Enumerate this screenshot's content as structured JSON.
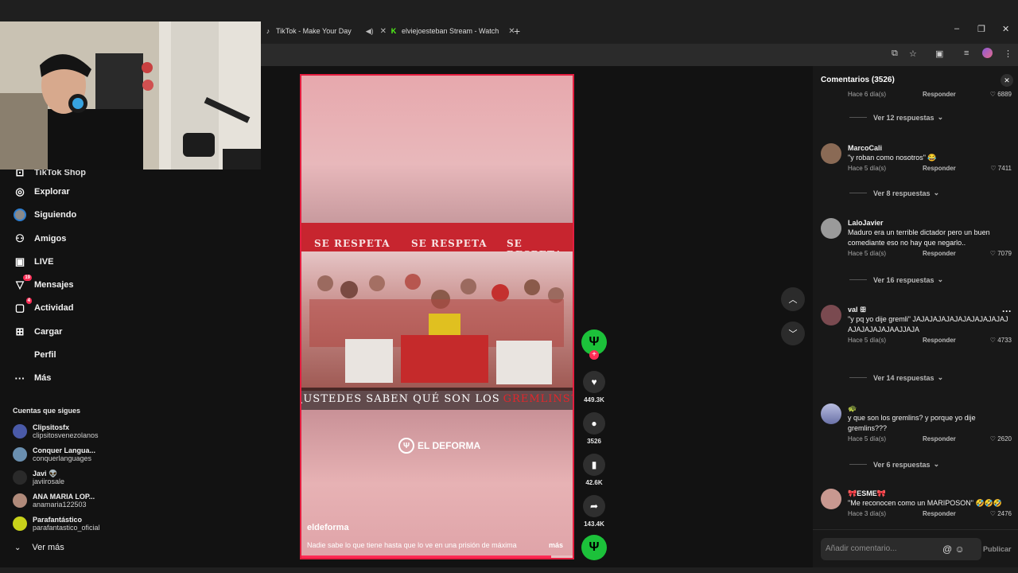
{
  "browser": {
    "tabs": [
      {
        "title": "TikTok - Make Your Day",
        "icon": "tiktok-icon"
      },
      {
        "title": "elviejoesteban Stream - Watch",
        "icon": "kick-icon"
      }
    ],
    "new_tab": "+",
    "window": {
      "minimize": "–",
      "restore": "❐",
      "close": "✕"
    }
  },
  "sidebar": {
    "partial_item": "TikTok Shop",
    "items": [
      {
        "label": "Explorar",
        "icon": "compass-icon",
        "glyph": "◎",
        "badge": ""
      },
      {
        "label": "Siguiendo",
        "icon": "following-icon",
        "glyph": "●",
        "badge": ""
      },
      {
        "label": "Amigos",
        "icon": "friends-icon",
        "glyph": "⚇",
        "badge": ""
      },
      {
        "label": "LIVE",
        "icon": "live-icon",
        "glyph": "▣",
        "badge": ""
      },
      {
        "label": "Mensajes",
        "icon": "messages-icon",
        "glyph": "▽",
        "badge": "19"
      },
      {
        "label": "Actividad",
        "icon": "activity-icon",
        "glyph": "▢",
        "badge": "4"
      },
      {
        "label": "Cargar",
        "icon": "upload-icon",
        "glyph": "⊞",
        "badge": ""
      },
      {
        "label": "Perfil",
        "icon": "profile-icon",
        "glyph": "",
        "badge": ""
      },
      {
        "label": "Más",
        "icon": "more-icon",
        "glyph": "···",
        "badge": ""
      }
    ],
    "following_title": "Cuentas que sigues",
    "following": [
      {
        "name": "Clipsitosfx",
        "handle": "clipsitosvenezolanos",
        "color": "#4a5aa8"
      },
      {
        "name": "Conquer Langua...",
        "handle": "conquerlanguages",
        "color": "#6a8fb0"
      },
      {
        "name": "Javi 👽",
        "handle": "javiirosale",
        "color": "#2a2a2a"
      },
      {
        "name": "ANA MARIA LOP...",
        "handle": "anamaria122503",
        "color": "#b08a7a"
      },
      {
        "name": "Parafantástico",
        "handle": "parafantastico_oficial",
        "color": "#c8d21a"
      }
    ],
    "see_more": "Ver más"
  },
  "video": {
    "banner_text": "SE RESPETA",
    "caption_white": "¿USTEDES SABEN QUÉ SON LOS",
    "caption_red": "GREMLINS?",
    "logo_text": "EL DEFORMA",
    "author": "eldeforma",
    "description": "Nadie sabe lo que tiene hasta que lo ve en una prisión de máxima",
    "more": "más",
    "progress": 0.92
  },
  "actions": {
    "likes": "449.3K",
    "comments": "3526",
    "saves": "42.6K",
    "shares": "143.4K"
  },
  "comments": {
    "title": "Comentarios (3526)",
    "top_partial": {
      "time": "Hace 6 día(s)",
      "reply": "Responder",
      "likes": "6889"
    },
    "items": [
      {
        "replies_before": "Ver 12 respuestas",
        "user": "MarcoCali",
        "text": "\"y roban como nosotros\" 😂",
        "time": "Hace 5 día(s)",
        "reply": "Responder",
        "likes": "7411",
        "color": "#8a6a55"
      },
      {
        "replies_before": "Ver 8 respuestas",
        "user": "LaloJavier",
        "text": "Maduro era un terrible dictador pero un buen comediante eso no hay que negarlo..",
        "time": "Hace 5 día(s)",
        "reply": "Responder",
        "likes": "7079",
        "color": "#9a9a9a"
      },
      {
        "replies_before": "Ver 16 respuestas",
        "user": "val ꕥ",
        "text": "\"y pq yo dije gremli\" JAJAJAJAJAJAJAJAJAJAJAJAJAJAJAJAJAAJJAJA",
        "time": "Hace 5 día(s)",
        "reply": "Responder",
        "likes": "4733",
        "color": "#7a4a50"
      },
      {
        "replies_before": "Ver 14 respuestas",
        "user": "🐢",
        "text": "y que son los gremlins? y porque yo dije gremlins???",
        "time": "Hace 5 día(s)",
        "reply": "Responder",
        "likes": "2620",
        "color": "#8a8fc0"
      },
      {
        "replies_before": "Ver 6 respuestas",
        "user": "🎀ESME🎀",
        "text": "\"Me reconocen como un MARIPOSON\" 🤣🤣🤣",
        "time": "Hace 3 día(s)",
        "reply": "Responder",
        "likes": "2476",
        "color": "#c89890"
      }
    ],
    "input_placeholder": "Añadir comentario...",
    "post": "Publicar"
  }
}
